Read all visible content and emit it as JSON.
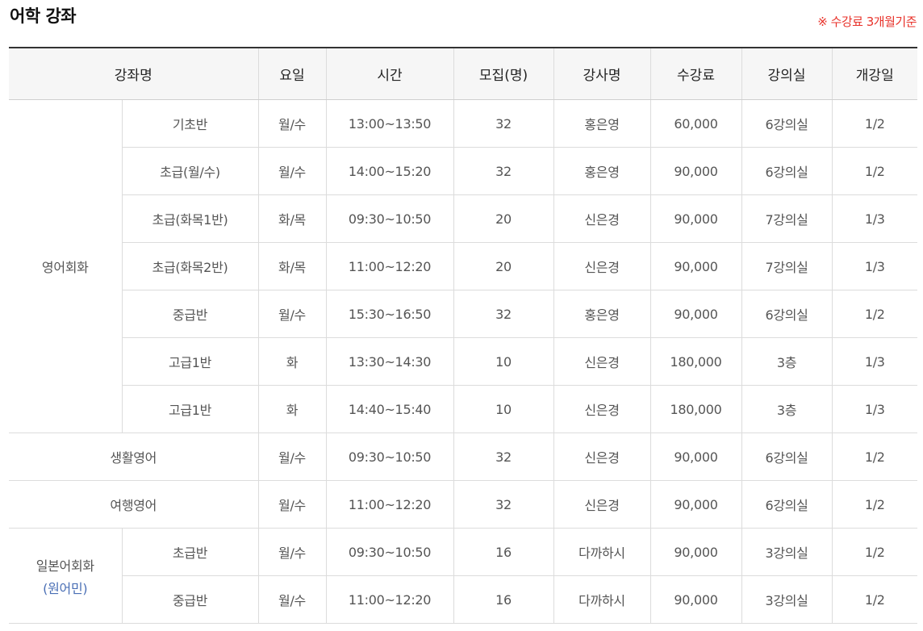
{
  "title": "어학 강좌",
  "note": "※ 수강료 3개월기준",
  "headers": [
    "강좌명",
    "요일",
    "시간",
    "모집(명)",
    "강사명",
    "수강료",
    "강의실",
    "개강일"
  ],
  "groups": {
    "english_conversation": "영어회화",
    "japanese_conversation": "일본어회화",
    "japanese_native": "(원어민)"
  },
  "rows": [
    {
      "name": "기초반",
      "day": "월/수",
      "time": "13:00~13:50",
      "cap": "32",
      "teacher": "홍은영",
      "fee": "60,000",
      "room": "6강의실",
      "start": "1/2"
    },
    {
      "name": "초급(월/수)",
      "day": "월/수",
      "time": "14:00~15:20",
      "cap": "32",
      "teacher": "홍은영",
      "fee": "90,000",
      "room": "6강의실",
      "start": "1/2"
    },
    {
      "name": "초급(화목1반)",
      "day": "화/목",
      "time": "09:30~10:50",
      "cap": "20",
      "teacher": "신은경",
      "fee": "90,000",
      "room": "7강의실",
      "start": "1/3"
    },
    {
      "name": "초급(화목2반)",
      "day": "화/목",
      "time": "11:00~12:20",
      "cap": "20",
      "teacher": "신은경",
      "fee": "90,000",
      "room": "7강의실",
      "start": "1/3"
    },
    {
      "name": "중급반",
      "day": "월/수",
      "time": "15:30~16:50",
      "cap": "32",
      "teacher": "홍은영",
      "fee": "90,000",
      "room": "6강의실",
      "start": "1/2"
    },
    {
      "name": "고급1반",
      "day": "화",
      "time": "13:30~14:30",
      "cap": "10",
      "teacher": "신은경",
      "fee": "180,000",
      "room": "3층",
      "start": "1/3"
    },
    {
      "name": "고급1반",
      "day": "화",
      "time": "14:40~15:40",
      "cap": "10",
      "teacher": "신은경",
      "fee": "180,000",
      "room": "3층",
      "start": "1/3"
    },
    {
      "name": "생활영어",
      "day": "월/수",
      "time": "09:30~10:50",
      "cap": "32",
      "teacher": "신은경",
      "fee": "90,000",
      "room": "6강의실",
      "start": "1/2"
    },
    {
      "name": "여행영어",
      "day": "월/수",
      "time": "11:00~12:20",
      "cap": "32",
      "teacher": "신은경",
      "fee": "90,000",
      "room": "6강의실",
      "start": "1/2"
    },
    {
      "name": "초급반",
      "day": "월/수",
      "time": "09:30~10:50",
      "cap": "16",
      "teacher": "다까하시",
      "fee": "90,000",
      "room": "3강의실",
      "start": "1/2"
    },
    {
      "name": "중급반",
      "day": "월/수",
      "time": "11:00~12:20",
      "cap": "16",
      "teacher": "다까하시",
      "fee": "90,000",
      "room": "3강의실",
      "start": "1/2"
    }
  ]
}
